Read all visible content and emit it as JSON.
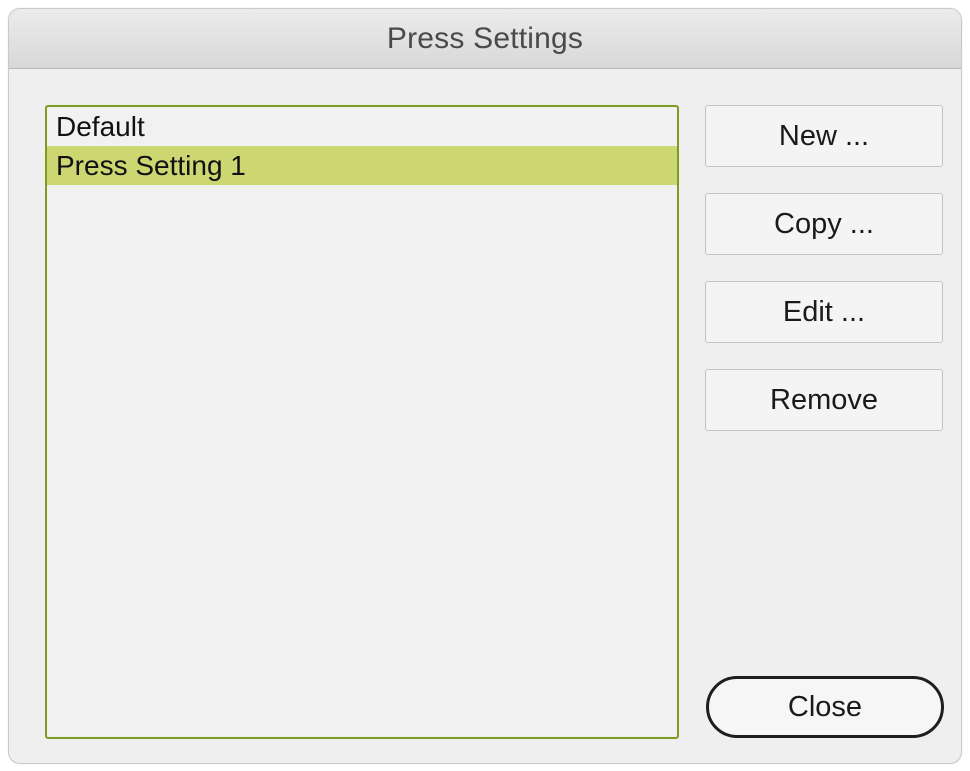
{
  "window": {
    "title": "Press Settings"
  },
  "settings_list": {
    "items": [
      {
        "label": "Default",
        "selected": false
      },
      {
        "label": "Press Setting 1",
        "selected": true
      }
    ],
    "selection_color": "#cdd772",
    "border_color": "#7f9a22"
  },
  "buttons": {
    "new_label": "New ...",
    "copy_label": "Copy ...",
    "edit_label": "Edit ...",
    "remove_label": "Remove",
    "close_label": "Close"
  }
}
